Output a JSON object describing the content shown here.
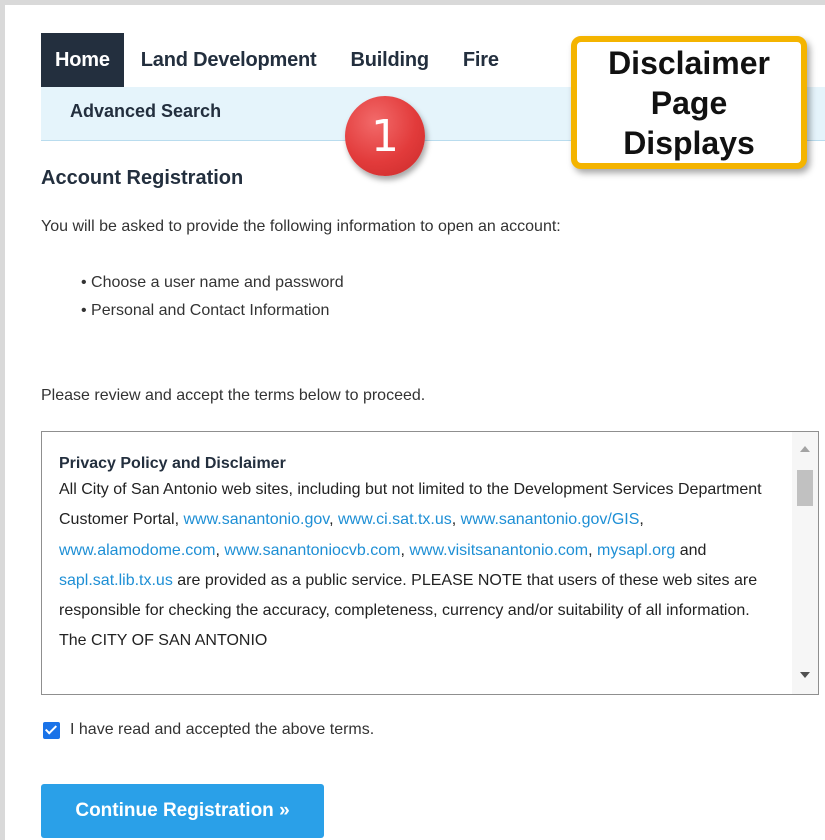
{
  "nav": {
    "tabs": [
      {
        "label": "Home",
        "active": true
      },
      {
        "label": "Land Development"
      },
      {
        "label": "Building"
      },
      {
        "label": "Fire"
      }
    ],
    "subnav": {
      "advanced_search": "Advanced Search"
    }
  },
  "overlay": {
    "step_marker": "1",
    "callout_lines": [
      "Disclaimer",
      "Page",
      "Displays"
    ]
  },
  "page": {
    "heading": "Account Registration",
    "intro": "You will be asked to provide the following information to open an account:",
    "bullets": [
      "Choose a user name and password",
      "Personal and Contact Information"
    ],
    "review_text": "Please review and accept the terms below to proceed."
  },
  "terms": {
    "title": "Privacy Policy and Disclaimer",
    "text_1": "All City of San Antonio web sites, including but not limited to the Development Services Department Customer Portal, ",
    "link_1": "www.sanantonio.gov",
    "sep_1": ", ",
    "link_2": "www.ci.sat.tx.us",
    "sep_2": ", ",
    "link_3": "www.sanantonio.gov/GIS",
    "sep_3": ", ",
    "link_4": "www.alamodome.com",
    "sep_4": ", ",
    "link_5": "www.sanantoniocvb.com",
    "sep_5": ", ",
    "link_6": "www.visitsanantonio.com",
    "sep_6": ", ",
    "link_7": "mysapl.org",
    "sep_7": " and ",
    "link_8": "sapl.sat.lib.tx.us",
    "text_2": " are provided as a public service. PLEASE NOTE that users of these web sites are responsible for checking the accuracy, completeness, currency and/or suitability of all information. The CITY OF SAN ANTONIO"
  },
  "accept": {
    "checked": true,
    "label": "I have read and accepted the above terms."
  },
  "continue_button": "Continue Registration »",
  "colors": {
    "nav_dark": "#232f3e",
    "subnav_bg": "#e5f4fb",
    "link": "#1e8fd5",
    "button": "#2aa0e8",
    "callout_border": "#f4b400",
    "marker": "#e23b3b"
  }
}
